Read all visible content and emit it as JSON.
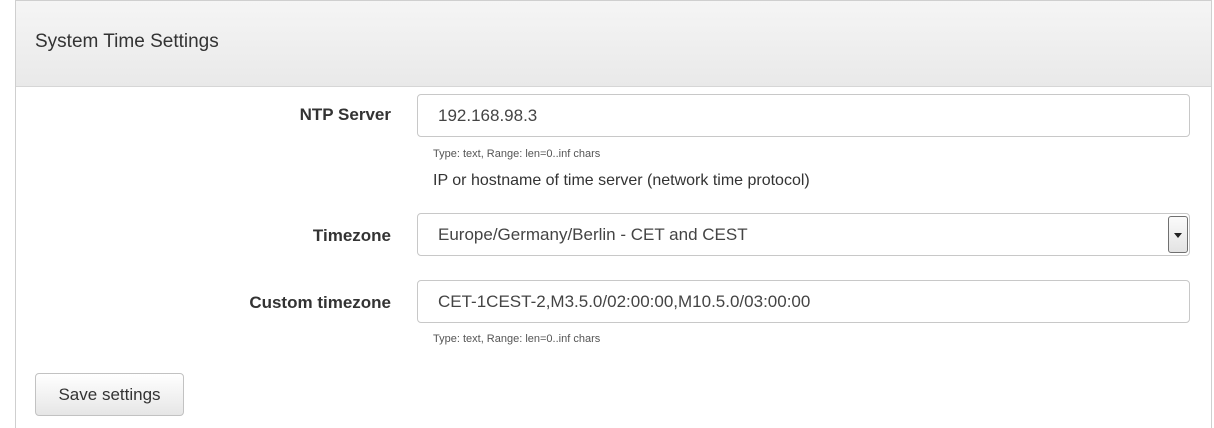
{
  "panel": {
    "title": "System Time Settings"
  },
  "form": {
    "ntp_server": {
      "label": "NTP Server",
      "value": "192.168.98.3",
      "type_hint": "Type: text, Range: len=0..inf chars",
      "description": "IP or hostname of time server (network time protocol)"
    },
    "timezone": {
      "label": "Timezone",
      "selected": "Europe/Germany/Berlin - CET and CEST",
      "dropdown_icon": "chevron-down-icon"
    },
    "custom_timezone": {
      "label": "Custom timezone",
      "value": "CET-1CEST-2,M3.5.0/02:00:00,M10.5.0/03:00:00",
      "type_hint": "Type: text, Range: len=0..inf chars"
    }
  },
  "actions": {
    "save_label": "Save settings"
  }
}
